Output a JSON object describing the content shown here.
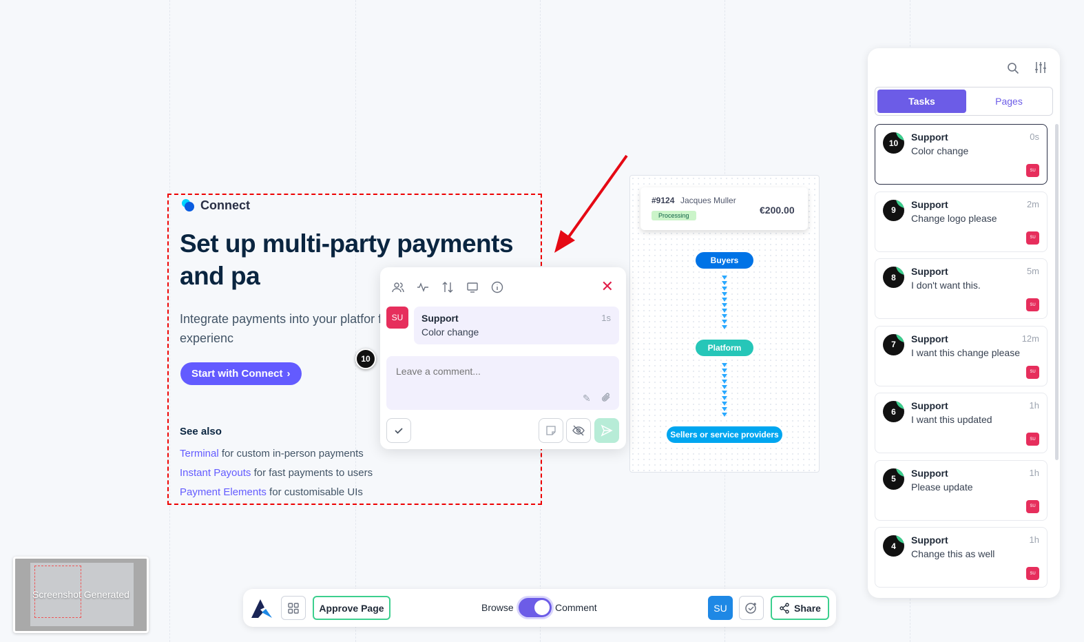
{
  "page": {
    "connect_name": "Connect",
    "headline": "Set up multi-party payments and pa",
    "subtext": "Integrate payments into your platfor for end-to-end payments experienc",
    "start_button": "Start with Connect",
    "see_also_title": "See also",
    "see_also": [
      {
        "link": "Terminal",
        "text": " for custom in-person payments"
      },
      {
        "link": "Instant Payouts",
        "text": " for fast payments to users"
      },
      {
        "link": "Payment Elements",
        "text": " for customisable UIs"
      }
    ]
  },
  "diagram": {
    "order_id": "#9124",
    "order_name": "Jacques Muller",
    "order_status": "Processing",
    "order_amount": "€200.00",
    "nodes": [
      "Buyers",
      "Platform",
      "Sellers or service providers"
    ]
  },
  "comment_popup": {
    "avatar": "SU",
    "author": "Support",
    "time": "1s",
    "text": "Color change",
    "placeholder": "Leave a comment...",
    "icons": [
      "users-icon",
      "activity-icon",
      "sort-icon",
      "monitor-icon",
      "info-icon"
    ]
  },
  "marker": {
    "number": "10"
  },
  "task_panel": {
    "tabs": {
      "tasks": "Tasks",
      "pages": "Pages"
    },
    "tasks": [
      {
        "num": "10",
        "author": "Support",
        "time": "0s",
        "text": "Color change",
        "avatar": "SU"
      },
      {
        "num": "9",
        "author": "Support",
        "time": "2m",
        "text": "Change logo please",
        "avatar": "SU"
      },
      {
        "num": "8",
        "author": "Support",
        "time": "5m",
        "text": "I don't want this.",
        "avatar": "SU"
      },
      {
        "num": "7",
        "author": "Support",
        "time": "12m",
        "text": "I want this change please",
        "avatar": "SU"
      },
      {
        "num": "6",
        "author": "Support",
        "time": "1h",
        "text": "I want this updated",
        "avatar": "SU"
      },
      {
        "num": "5",
        "author": "Support",
        "time": "1h",
        "text": "Please update",
        "avatar": "SU"
      },
      {
        "num": "4",
        "author": "Support",
        "time": "1h",
        "text": "Change this as well",
        "avatar": "SU"
      }
    ]
  },
  "toolbar": {
    "approve": "Approve Page",
    "browse": "Browse",
    "comment": "Comment",
    "user": "SU",
    "share": "Share"
  },
  "thumbnail": {
    "label": "Screenshot Generated"
  },
  "colors": {
    "accent": "#6c5ce7",
    "approve_border": "#3ccf8e",
    "stripe_purple": "#635bff",
    "selection": "#ee0000"
  }
}
